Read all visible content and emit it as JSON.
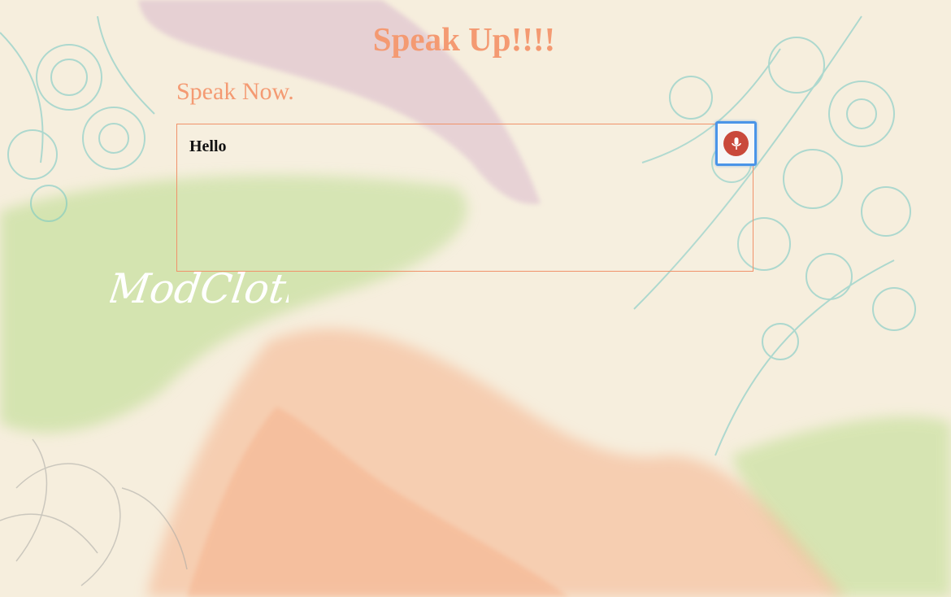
{
  "header": {
    "title": "Speak Up!!!!"
  },
  "main": {
    "prompt": "Speak Now.",
    "transcript": "Hello",
    "mic_icon": "microphone-icon"
  },
  "brand": {
    "logo_text": "ModCloth"
  },
  "colors": {
    "accent": "#f49a72",
    "background": "#f6eedd",
    "mic": "#c9493c",
    "focus_ring": "#4a94e8"
  }
}
